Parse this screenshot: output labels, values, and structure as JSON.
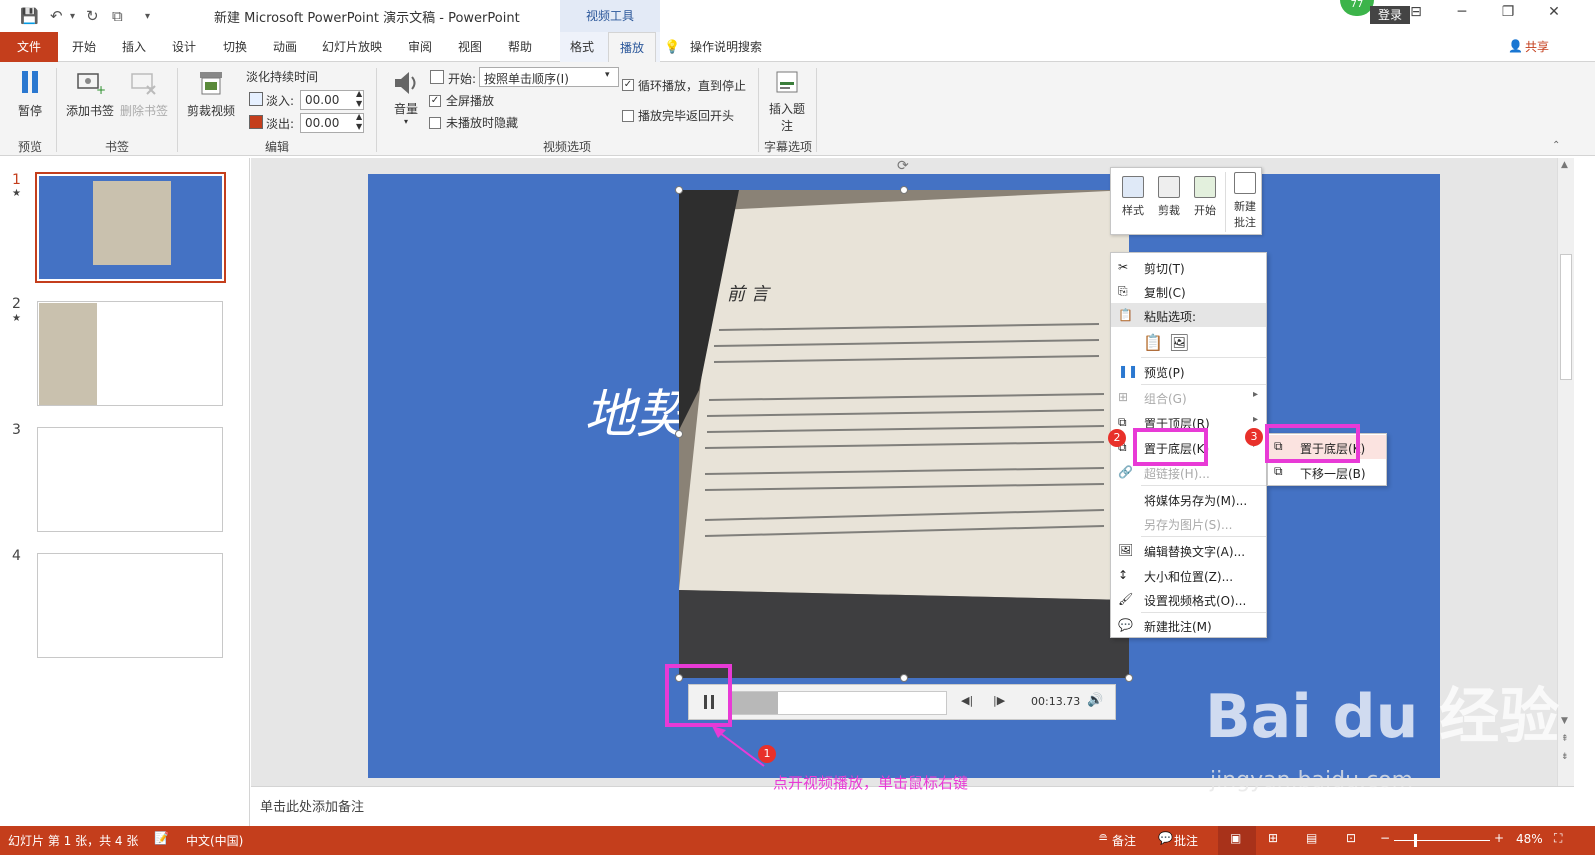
{
  "titlebar": {
    "title": "新建 Microsoft PowerPoint 演示文稿  -  PowerPoint",
    "context_tab_group": "视频工具",
    "login": "登录",
    "badge_number": "77",
    "minimize_glyph": "─",
    "restore_glyph": "❐",
    "close_glyph": "✕",
    "ribbon_display_glyph": "⊟"
  },
  "tabs": {
    "file": "文件",
    "items": [
      "开始",
      "插入",
      "设计",
      "切换",
      "动画",
      "幻灯片放映",
      "审阅",
      "视图",
      "帮助",
      "格式",
      "播放"
    ],
    "active": "播放",
    "search": "操作说明搜索",
    "share": "共享"
  },
  "ribbon": {
    "preview": {
      "pause": "暂停",
      "group": "预览"
    },
    "bookmarks": {
      "add": "添加书签",
      "remove": "删除书签",
      "group": "书签"
    },
    "editing": {
      "trim": "剪裁视频",
      "fade_title": "淡化持续时间",
      "fade_in_label": "淡入:",
      "fade_in_value": "00.00",
      "fade_out_label": "淡出:",
      "fade_out_value": "00.00",
      "group": "编辑"
    },
    "video_options": {
      "volume": "音量",
      "start_label": "开始:",
      "start_value": "按照单击顺序(I)",
      "fullscreen": "全屏播放",
      "hide_not_playing": "未播放时隐藏",
      "loop": "循环播放，直到停止",
      "rewind": "播放完毕返回开头",
      "group": "视频选项",
      "loop_checked": true,
      "fullscreen_checked": true,
      "hide_checked": false,
      "rewind_checked": false
    },
    "captions": {
      "insert_line1": "插入题",
      "insert_line2": "注",
      "group": "字幕选项"
    }
  },
  "thumbnails": [
    {
      "num": "1",
      "star": "★"
    },
    {
      "num": "2",
      "star": "★"
    },
    {
      "num": "3",
      "star": ""
    },
    {
      "num": "4",
      "star": ""
    }
  ],
  "slide": {
    "title": "地契",
    "video_time": "00:13.73",
    "video_progress": 0.22,
    "book_heading": "前  言"
  },
  "minibar": {
    "items": [
      "样式",
      "剪裁",
      "开始",
      "新建",
      "批注"
    ]
  },
  "context_menu": {
    "cut": "剪切(T)",
    "copy": "复制(C)",
    "paste_options": "粘贴选项:",
    "preview": "预览(P)",
    "group": "组合(G)",
    "bring_to_front": "置于顶层(R)",
    "send_to_back": "置于底层(K)",
    "hyperlink": "超链接(H)...",
    "save_media": "将媒体另存为(M)...",
    "save_picture": "另存为图片(S)...",
    "alt_text": "编辑替换文字(A)...",
    "size_position": "大小和位置(Z)...",
    "format_video": "设置视频格式(O)...",
    "new_comment": "新建批注(M)"
  },
  "submenu": {
    "send_to_back": "置于底层(K)",
    "send_backward": "下移一层(B)"
  },
  "annotations": {
    "badge1": "1",
    "badge2": "2",
    "badge3": "3",
    "note": "点开视频播放，单击鼠标右键",
    "watermark_main": "Bai du 经验",
    "watermark_url": "jingyan.baidu.com"
  },
  "notes": {
    "placeholder": "单击此处添加备注"
  },
  "statusbar": {
    "slide_info": "幻灯片 第 1 张，共 4 张",
    "language": "中文(中国)",
    "notes": "备注",
    "comments": "批注",
    "zoom": "48%"
  },
  "colors": {
    "accent": "#c43e1c",
    "slide_bg": "#4472c4",
    "annotation": "#e83ad6",
    "badge": "#e8302a"
  }
}
